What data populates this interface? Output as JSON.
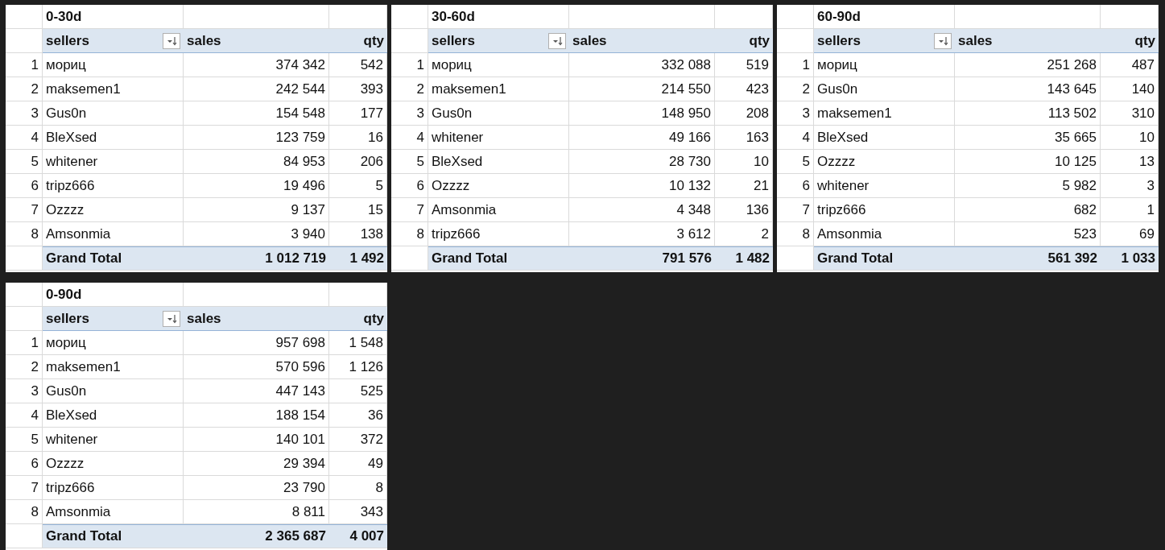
{
  "pivots": [
    {
      "title": "0-30d",
      "columns": [
        "sellers",
        "sales",
        "qty"
      ],
      "rows": [
        {
          "n": "1",
          "seller": "мориц",
          "sales": "374 342",
          "qty": "542"
        },
        {
          "n": "2",
          "seller": "maksemen1",
          "sales": "242 544",
          "qty": "393"
        },
        {
          "n": "3",
          "seller": "Gus0n",
          "sales": "154 548",
          "qty": "177"
        },
        {
          "n": "4",
          "seller": "BleXsed",
          "sales": "123 759",
          "qty": "16"
        },
        {
          "n": "5",
          "seller": "whitener",
          "sales": "84 953",
          "qty": "206"
        },
        {
          "n": "6",
          "seller": "tripz666",
          "sales": "19 496",
          "qty": "5"
        },
        {
          "n": "7",
          "seller": "Ozzzz",
          "sales": "9 137",
          "qty": "15"
        },
        {
          "n": "8",
          "seller": "Amsonmia",
          "sales": "3 940",
          "qty": "138"
        }
      ],
      "total": {
        "label": "Grand Total",
        "sales": "1 012 719",
        "qty": "1 492"
      }
    },
    {
      "title": "30-60d",
      "columns": [
        "sellers",
        "sales",
        "qty"
      ],
      "rows": [
        {
          "n": "1",
          "seller": "мориц",
          "sales": "332 088",
          "qty": "519"
        },
        {
          "n": "2",
          "seller": "maksemen1",
          "sales": "214 550",
          "qty": "423"
        },
        {
          "n": "3",
          "seller": "Gus0n",
          "sales": "148 950",
          "qty": "208"
        },
        {
          "n": "4",
          "seller": "whitener",
          "sales": "49 166",
          "qty": "163"
        },
        {
          "n": "5",
          "seller": "BleXsed",
          "sales": "28 730",
          "qty": "10"
        },
        {
          "n": "6",
          "seller": "Ozzzz",
          "sales": "10 132",
          "qty": "21"
        },
        {
          "n": "7",
          "seller": "Amsonmia",
          "sales": "4 348",
          "qty": "136"
        },
        {
          "n": "8",
          "seller": "tripz666",
          "sales": "3 612",
          "qty": "2"
        }
      ],
      "total": {
        "label": "Grand Total",
        "sales": "791 576",
        "qty": "1 482"
      }
    },
    {
      "title": "60-90d",
      "columns": [
        "sellers",
        "sales",
        "qty"
      ],
      "rows": [
        {
          "n": "1",
          "seller": "мориц",
          "sales": "251 268",
          "qty": "487"
        },
        {
          "n": "2",
          "seller": "Gus0n",
          "sales": "143 645",
          "qty": "140"
        },
        {
          "n": "3",
          "seller": "maksemen1",
          "sales": "113 502",
          "qty": "310"
        },
        {
          "n": "4",
          "seller": "BleXsed",
          "sales": "35 665",
          "qty": "10"
        },
        {
          "n": "5",
          "seller": "Ozzzz",
          "sales": "10 125",
          "qty": "13"
        },
        {
          "n": "6",
          "seller": "whitener",
          "sales": "5 982",
          "qty": "3"
        },
        {
          "n": "7",
          "seller": "tripz666",
          "sales": "682",
          "qty": "1"
        },
        {
          "n": "8",
          "seller": "Amsonmia",
          "sales": "523",
          "qty": "69"
        }
      ],
      "total": {
        "label": "Grand Total",
        "sales": "561 392",
        "qty": "1 033"
      }
    },
    {
      "title": "0-90d",
      "columns": [
        "sellers",
        "sales",
        "qty"
      ],
      "rows": [
        {
          "n": "1",
          "seller": "мориц",
          "sales": "957 698",
          "qty": "1 548"
        },
        {
          "n": "2",
          "seller": "maksemen1",
          "sales": "570 596",
          "qty": "1 126"
        },
        {
          "n": "3",
          "seller": "Gus0n",
          "sales": "447 143",
          "qty": "525"
        },
        {
          "n": "4",
          "seller": "BleXsed",
          "sales": "188 154",
          "qty": "36"
        },
        {
          "n": "5",
          "seller": "whitener",
          "sales": "140 101",
          "qty": "372"
        },
        {
          "n": "6",
          "seller": "Ozzzz",
          "sales": "29 394",
          "qty": "49"
        },
        {
          "n": "7",
          "seller": "tripz666",
          "sales": "23 790",
          "qty": "8"
        },
        {
          "n": "8",
          "seller": "Amsonmia",
          "sales": "8 811",
          "qty": "343"
        }
      ],
      "total": {
        "label": "Grand Total",
        "sales": "2 365 687",
        "qty": "4 007"
      }
    }
  ]
}
